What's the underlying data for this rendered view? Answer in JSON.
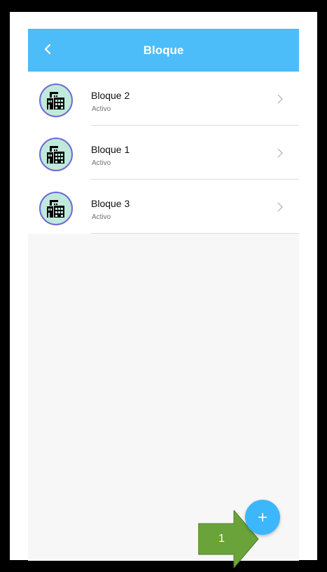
{
  "header": {
    "title": "Bloque",
    "back_icon": "chevron-left-icon"
  },
  "list": {
    "items": [
      {
        "title": "Bloque 2",
        "status": "Activo",
        "icon": "building-icon"
      },
      {
        "title": "Bloque 1",
        "status": "Activo",
        "icon": "building-icon"
      },
      {
        "title": "Bloque 3",
        "status": "Activo",
        "icon": "building-icon"
      }
    ]
  },
  "fab": {
    "icon": "plus-icon"
  },
  "annotation": {
    "step_number": "1",
    "icon": "arrow-right-icon"
  },
  "colors": {
    "app_bar": "#4cbdf8",
    "fab": "#3db7fb",
    "avatar_bg": "#bfeadb",
    "avatar_border": "#6e6ad6",
    "annotation_arrow": "#6aa339"
  }
}
